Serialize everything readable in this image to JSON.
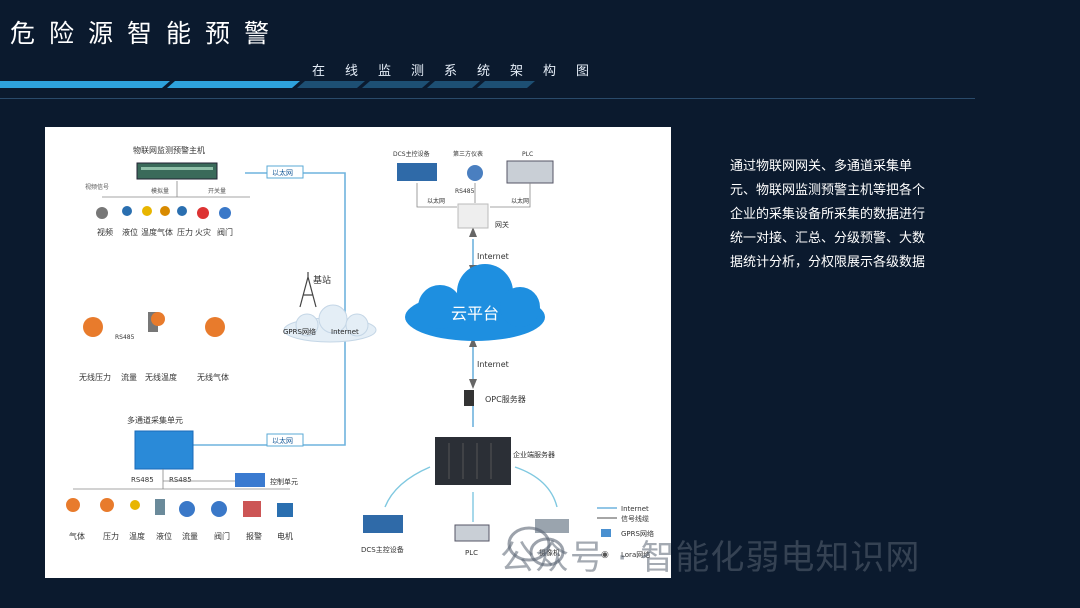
{
  "header": {
    "title": "危险源智能预警",
    "subtitle": "在线监测系统架构图"
  },
  "description": "通过物联网网关、多通道采集单元、物联网监测预警主机等把各个企业的采集设备所采集的数据进行统一对接、汇总、分级预警、大数据统计分析，分权限展示各级数据",
  "watermark": "公众号 · 智能化弱电知识网",
  "diagram": {
    "host_label": "物联网监测预警主机",
    "ethernet_label": "以太网",
    "host_sub": {
      "video_signal": "视频信号",
      "analog": "模拟量",
      "switch": "开关量"
    },
    "host_devices": [
      "视频",
      "液位",
      "温度",
      "气体",
      "压力",
      "火灾",
      "阀门"
    ],
    "top_devices": {
      "dcs": "DCS主控设备",
      "third_party": "第三方仪表",
      "plc": "PLC",
      "rs485": "RS485",
      "ethernet": "以太网",
      "gateway": "网关"
    },
    "internet": "Internet",
    "cloud": "云平台",
    "base_station": "基站",
    "gprs": "GPRS网络",
    "wireless": {
      "rs485": "RS485",
      "items": [
        "无线压力",
        "流量",
        "无线温度",
        "无线气体"
      ]
    },
    "opc": "OPC服务器",
    "enterprise_server": "企业端服务器",
    "multi_unit": "多通道采集单元",
    "multi_rs485_a": "RS485",
    "multi_rs485_b": "RS485",
    "control_unit": "控制单元",
    "bottom_devices": [
      "气体",
      "压力",
      "温度",
      "液位",
      "流量",
      "阀门",
      "报警",
      "电机"
    ],
    "client_devices": {
      "dcs": "DCS主控设备",
      "plc": "PLC",
      "camera": "摄像机"
    },
    "legend": [
      "Internet",
      "信号线缆",
      "GPRS网络",
      "Lora网络"
    ]
  },
  "colors": {
    "background": "#0b1a2e",
    "accent": "#2fa8e0",
    "cloud": "#1e90e0",
    "line": "#5aa9d6"
  }
}
